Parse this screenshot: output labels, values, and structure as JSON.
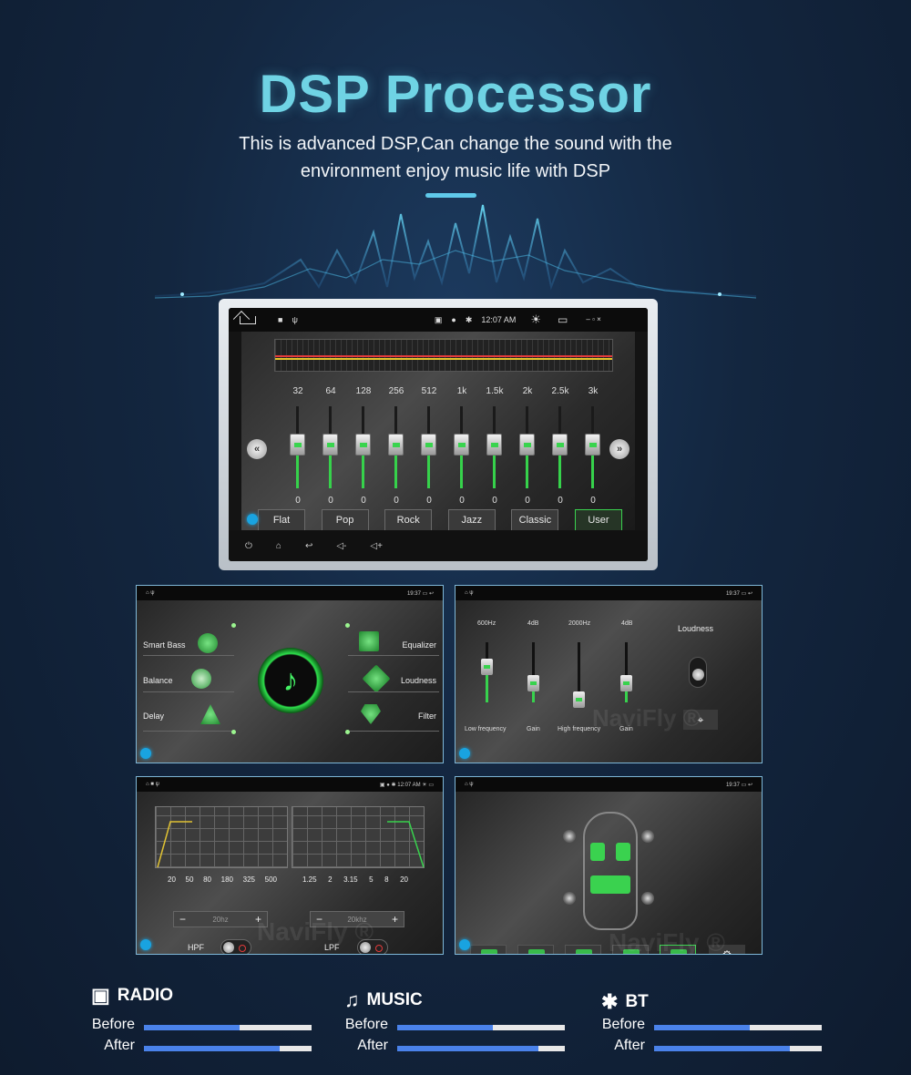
{
  "header": {
    "title": "DSP Processor",
    "subtitle_line1": "This is advanced DSP,Can change the sound with the",
    "subtitle_line2": "environment enjoy music life with DSP"
  },
  "main_screen": {
    "status": {
      "time": "12:07 AM"
    },
    "eq_bands": [
      {
        "freq": "32",
        "value": "0"
      },
      {
        "freq": "64",
        "value": "0"
      },
      {
        "freq": "128",
        "value": "0"
      },
      {
        "freq": "256",
        "value": "0"
      },
      {
        "freq": "512",
        "value": "0"
      },
      {
        "freq": "1k",
        "value": "0"
      },
      {
        "freq": "1.5k",
        "value": "0"
      },
      {
        "freq": "2k",
        "value": "0"
      },
      {
        "freq": "2.5k",
        "value": "0"
      },
      {
        "freq": "3k",
        "value": "0"
      }
    ],
    "presets": [
      "Flat",
      "Pop",
      "Rock",
      "Jazz",
      "Classic",
      "User"
    ],
    "active_preset": "User",
    "colors": {
      "accent_green": "#36d24b",
      "curve_red": "#e53b3b",
      "curve_yellow": "#e3c52b"
    }
  },
  "menu_screen": {
    "time": "19:37",
    "left_items": [
      "Smart Bass",
      "Balance",
      "Delay"
    ],
    "right_items": [
      "Equalizer",
      "Loudness",
      "Filter"
    ],
    "center_icon": "music-note-icon"
  },
  "bass_screen": {
    "time": "19:37",
    "top_labels": [
      "600Hz",
      "4dB",
      "2000Hz",
      "4dB"
    ],
    "bottom_labels": [
      "Low frequency",
      "Gain",
      "High frequency",
      "Gain"
    ],
    "loudness_label": "Loudness",
    "watermark": "NaviFly ®"
  },
  "filter_screen": {
    "time": "12:07 AM",
    "hpf_ticks": [
      "20",
      "50",
      "80",
      "180",
      "325",
      "500"
    ],
    "lpf_ticks": [
      "1.25",
      "2",
      "3.15",
      "5",
      "8",
      "20"
    ],
    "hpf_value": "20hz",
    "lpf_value": "20khz",
    "hpf_label": "HPF",
    "lpf_label": "LPF",
    "watermark": "NaviFly ®"
  },
  "seat_screen": {
    "time": "19:37",
    "watermark": "NaviFly ®"
  },
  "comparisons": [
    {
      "name": "RADIO",
      "icon": "radio-icon",
      "before_label": "Before",
      "after_label": "After",
      "before_level": 0.57,
      "after_level": 0.81
    },
    {
      "name": "MUSIC",
      "icon": "music-icon",
      "before_label": "Before",
      "after_label": "After",
      "before_level": 0.57,
      "after_level": 0.84
    },
    {
      "name": "BT",
      "icon": "bluetooth-icon",
      "before_label": "Before",
      "after_label": "After",
      "before_level": 0.57,
      "after_level": 0.81
    }
  ]
}
